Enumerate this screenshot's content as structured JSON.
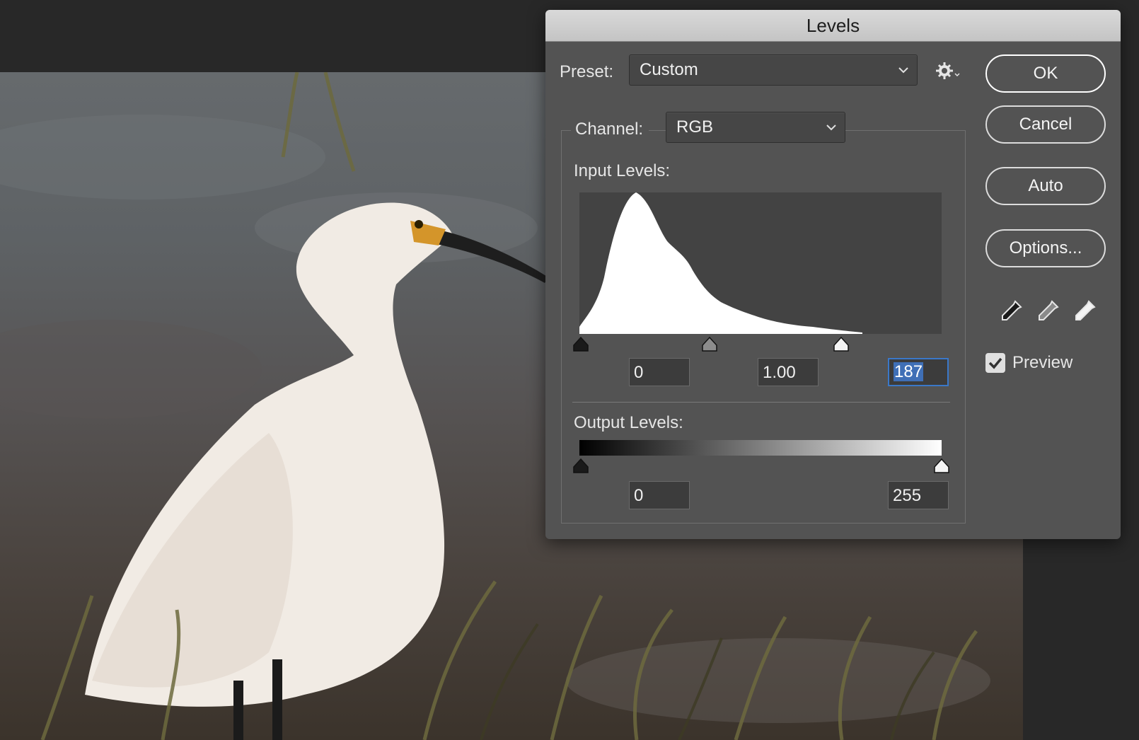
{
  "dialog": {
    "title": "Levels",
    "preset": {
      "label": "Preset:",
      "value": "Custom"
    },
    "channel": {
      "label": "Channel:",
      "value": "RGB"
    },
    "input_levels": {
      "label": "Input Levels:",
      "black": "0",
      "gamma": "1.00",
      "white": "187"
    },
    "output_levels": {
      "label": "Output Levels:",
      "black": "0",
      "white": "255"
    },
    "buttons": {
      "ok": "OK",
      "cancel": "Cancel",
      "auto": "Auto",
      "options": "Options..."
    },
    "preview": {
      "label": "Preview",
      "checked": true
    },
    "eyedroppers": [
      "black-point-eyedropper-icon",
      "gray-point-eyedropper-icon",
      "white-point-eyedropper-icon"
    ]
  },
  "colors": {
    "dialog_bg": "#535353",
    "accent": "#3a78c9",
    "titlebar": "#cfcfcf"
  }
}
